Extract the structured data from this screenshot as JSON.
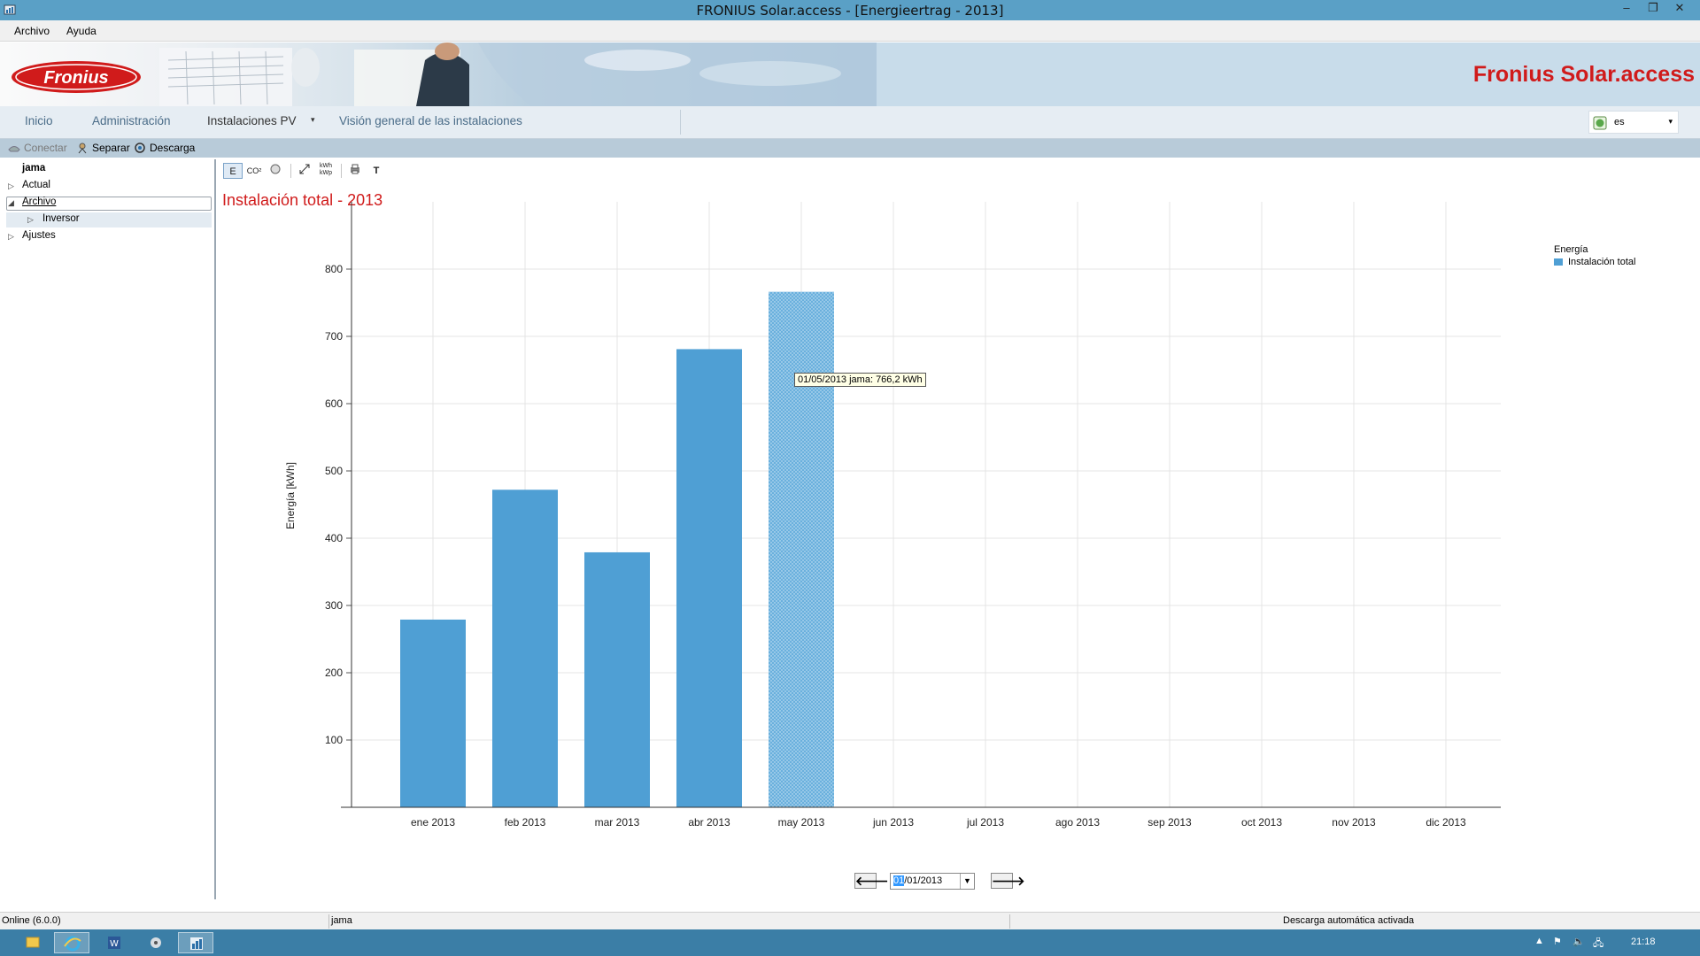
{
  "window": {
    "title": "FRONIUS Solar.access - [Energieertrag - 2013]",
    "controls": [
      "–",
      "❐",
      "✕"
    ]
  },
  "menu": {
    "file": "Archivo",
    "help": "Ayuda"
  },
  "banner": {
    "logo_text": "Fronius",
    "brand": "Fronius Solar.access"
  },
  "nav": {
    "tabs": [
      "Inicio",
      "Administración",
      "Instalaciones PV",
      "Visión general de las instalaciones"
    ],
    "active_tab": "Instalaciones PV",
    "language": "es"
  },
  "toolbar": {
    "connect": "Conectar",
    "disconnect": "Separar",
    "download": "Descarga"
  },
  "tree": {
    "root": "jama",
    "items": [
      "Actual",
      "Archivo",
      "Inversor",
      "Ajustes"
    ]
  },
  "chart_tools": {
    "energy": "E",
    "co2": "CO²",
    "kwp": "kWh kWp",
    "text": "T"
  },
  "content": {
    "title": "Instalación total - 2013"
  },
  "chart_data": {
    "type": "bar",
    "categories": [
      "ene 2013",
      "feb 2013",
      "mar 2013",
      "abr 2013",
      "may 2013",
      "jun 2013",
      "jul 2013",
      "ago 2013",
      "sep 2013",
      "oct 2013",
      "nov 2013",
      "dic 2013"
    ],
    "series": [
      {
        "name": "Instalación total",
        "values": [
          279,
          472,
          379,
          681,
          766.2,
          null,
          null,
          null,
          null,
          null,
          null,
          null
        ]
      }
    ],
    "ylabel": "Energía [kWh]",
    "xlabel": "",
    "ylim": [
      0,
      900
    ],
    "yticks": [
      100,
      200,
      300,
      400,
      500,
      600,
      700,
      800
    ],
    "legend_title": "Energía",
    "legend_position": "top-right",
    "grid": true,
    "highlight_index": 4,
    "tooltip": "01/05/2013 jama: 766,2 kWh",
    "bar_color": "#4f9fd4"
  },
  "date_nav": {
    "date": "01/01/2013",
    "date_sel": "01",
    "date_rest": "/01/2013"
  },
  "status": {
    "version": "Online (6.0.0)",
    "plant": "jama",
    "download_status": "Descarga automática activada"
  },
  "taskbar": {
    "clock": "21:18"
  }
}
